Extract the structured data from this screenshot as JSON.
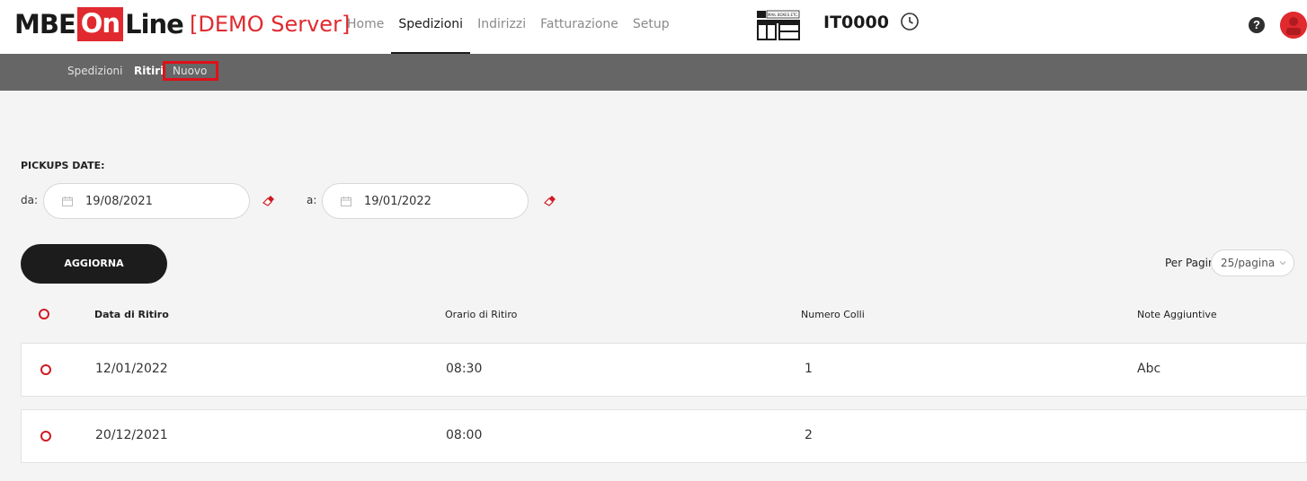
{
  "header": {
    "logo": {
      "part1": "MBE",
      "part2": "On",
      "part3": "Line"
    },
    "server_label": "[DEMO Server]",
    "nav": [
      {
        "label": "Home",
        "active": false
      },
      {
        "label": "Spedizioni",
        "active": true
      },
      {
        "label": "Indirizzi",
        "active": false
      },
      {
        "label": "Fatturazione",
        "active": false
      },
      {
        "label": "Setup",
        "active": false
      }
    ],
    "store_code": "IT0000",
    "store_icon_text": "MAIL BOXES ETC.",
    "help_glyph": "?"
  },
  "subnav": {
    "items": [
      "Spedizioni",
      "Ritiri",
      "Nuovo"
    ]
  },
  "filters": {
    "section_label": "PICKUPS DATE:",
    "from_label": "da:",
    "from_value": "19/08/2021",
    "to_label": "a:",
    "to_value": "19/01/2022"
  },
  "actions": {
    "refresh_label": "AGGIORNA"
  },
  "pagination": {
    "label": "Per Pagina",
    "value": "25/pagina"
  },
  "table": {
    "headers": [
      "Data di Ritiro",
      "Orario di Ritiro",
      "Numero Colli",
      "Note Aggiuntive"
    ],
    "rows": [
      {
        "date": "12/01/2022",
        "time": "08:30",
        "packages": "1",
        "notes": "Abc"
      },
      {
        "date": "20/12/2021",
        "time": "08:00",
        "packages": "2",
        "notes": ""
      }
    ]
  },
  "colors": {
    "brand_red": "#e02a2f",
    "dark": "#1c1c1c",
    "subnav_bg": "#666666",
    "page_bg": "#f4f4f4"
  }
}
